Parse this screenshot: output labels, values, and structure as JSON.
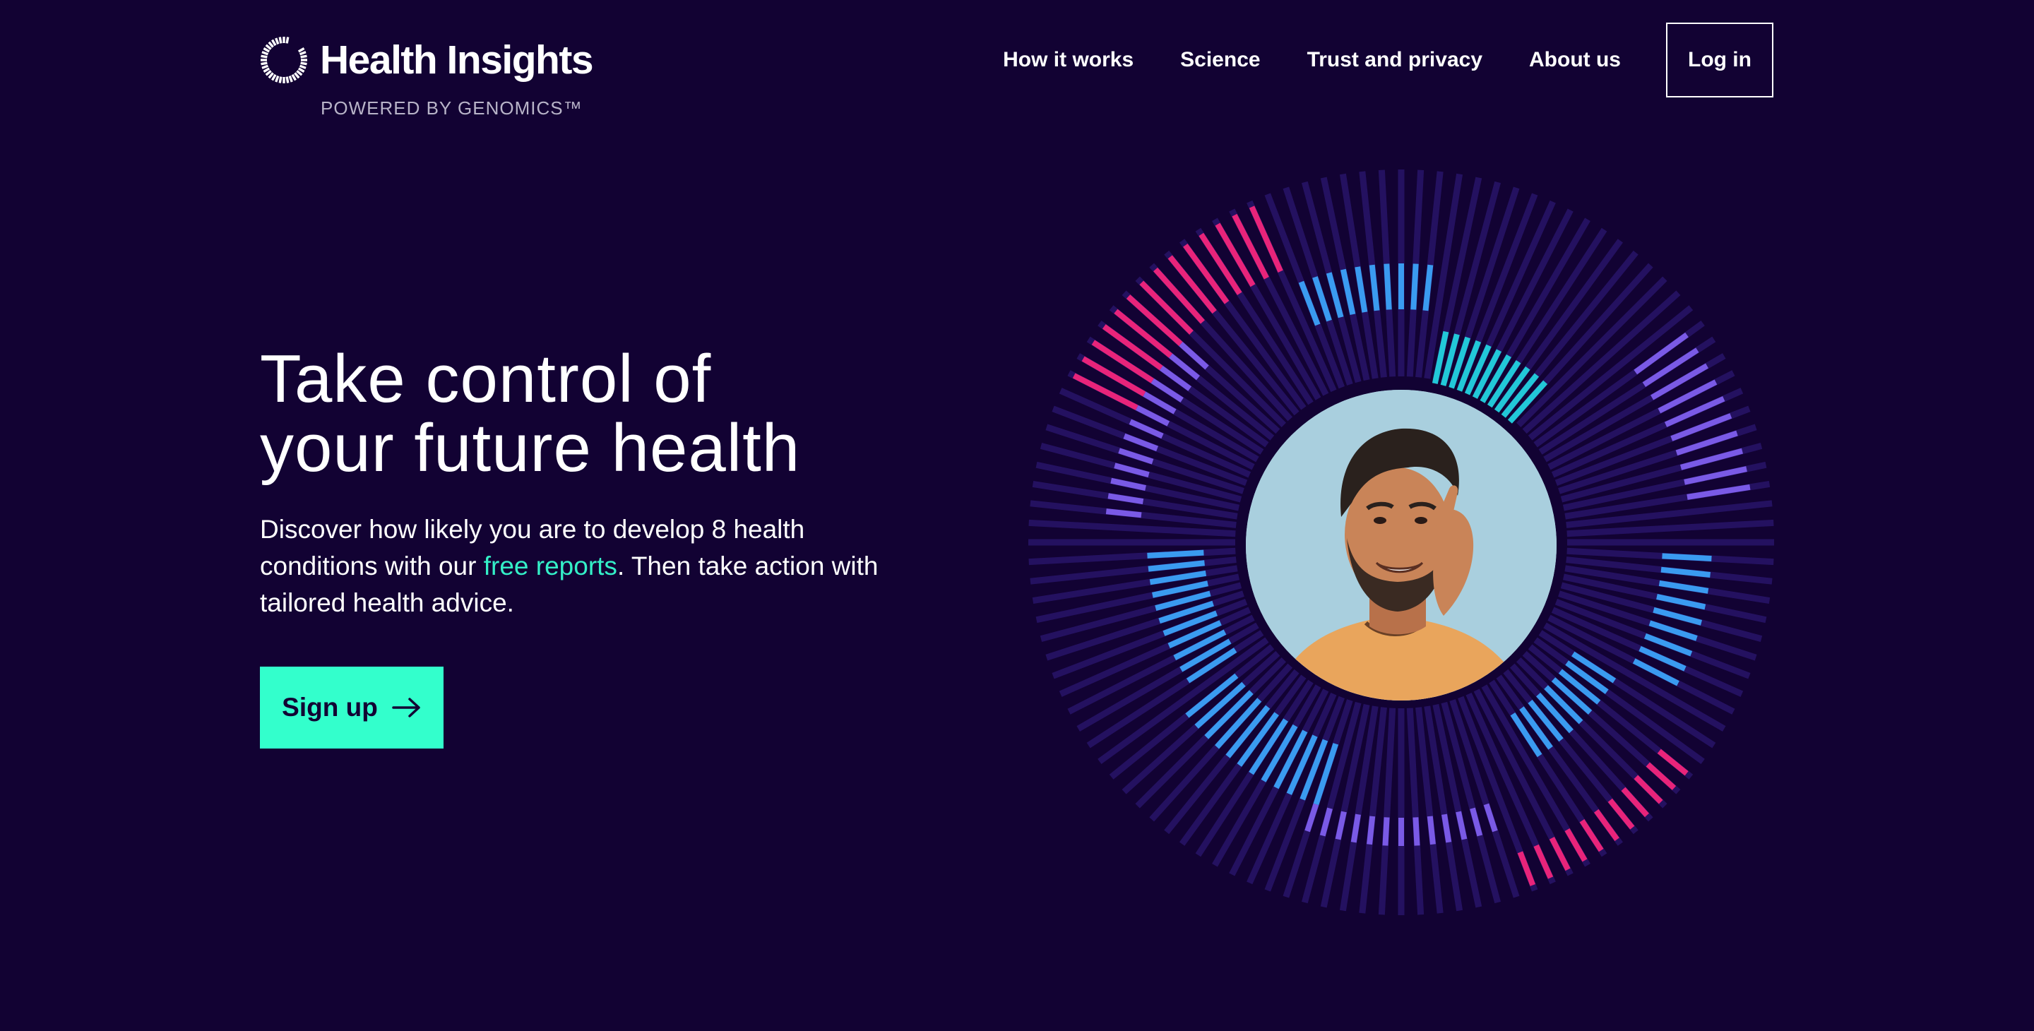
{
  "header": {
    "brand_title": "Health Insights",
    "brand_subtitle": "POWERED BY GENOMICS™",
    "nav": [
      {
        "label": "How it works"
      },
      {
        "label": "Science"
      },
      {
        "label": "Trust and privacy"
      },
      {
        "label": "About us"
      }
    ],
    "login_label": "Log in"
  },
  "hero": {
    "title_line1": "Take control of",
    "title_line2": "your future health",
    "desc_part1": "Discover how likely you are to develop 8 health conditions with our ",
    "desc_link": "free reports",
    "desc_part2": ". Then take action with tailored health advice.",
    "cta_label": "Sign up"
  },
  "colors": {
    "background": "#120233",
    "accent": "#33ffcc",
    "link": "#34f0c8",
    "ray_base": "#2a1670",
    "ray_blue": "#3a9bf0",
    "ray_teal": "#22c8d8",
    "ray_pink": "#e8247a",
    "ray_violet": "#7a5ae6"
  },
  "icons": {
    "logo": "ring-logo-icon",
    "cta_arrow": "arrow-right-icon",
    "avatar": "user-portrait-icon"
  }
}
